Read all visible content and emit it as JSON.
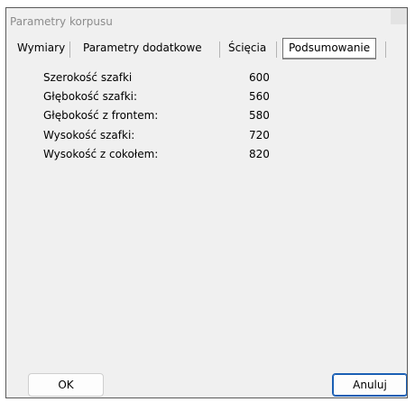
{
  "window": {
    "title": "Parametry korpusu"
  },
  "tabs": [
    {
      "label": "Wymiary",
      "active": false
    },
    {
      "label": "Parametry dodatkowe",
      "active": false
    },
    {
      "label": "Ścięcia",
      "active": false
    },
    {
      "label": "Podsumowanie",
      "active": true
    }
  ],
  "summary": {
    "rows": [
      {
        "label": "Szerokość szafki",
        "value": "600"
      },
      {
        "label": "Głębokość szafki:",
        "value": "560"
      },
      {
        "label": "Głębokość z frontem:",
        "value": "580"
      },
      {
        "label": "Wysokość szafki:",
        "value": "720"
      },
      {
        "label": "Wysokość z cokołem:",
        "value": "820"
      }
    ]
  },
  "buttons": {
    "ok_label": "OK",
    "cancel_label": "Anuluj"
  }
}
